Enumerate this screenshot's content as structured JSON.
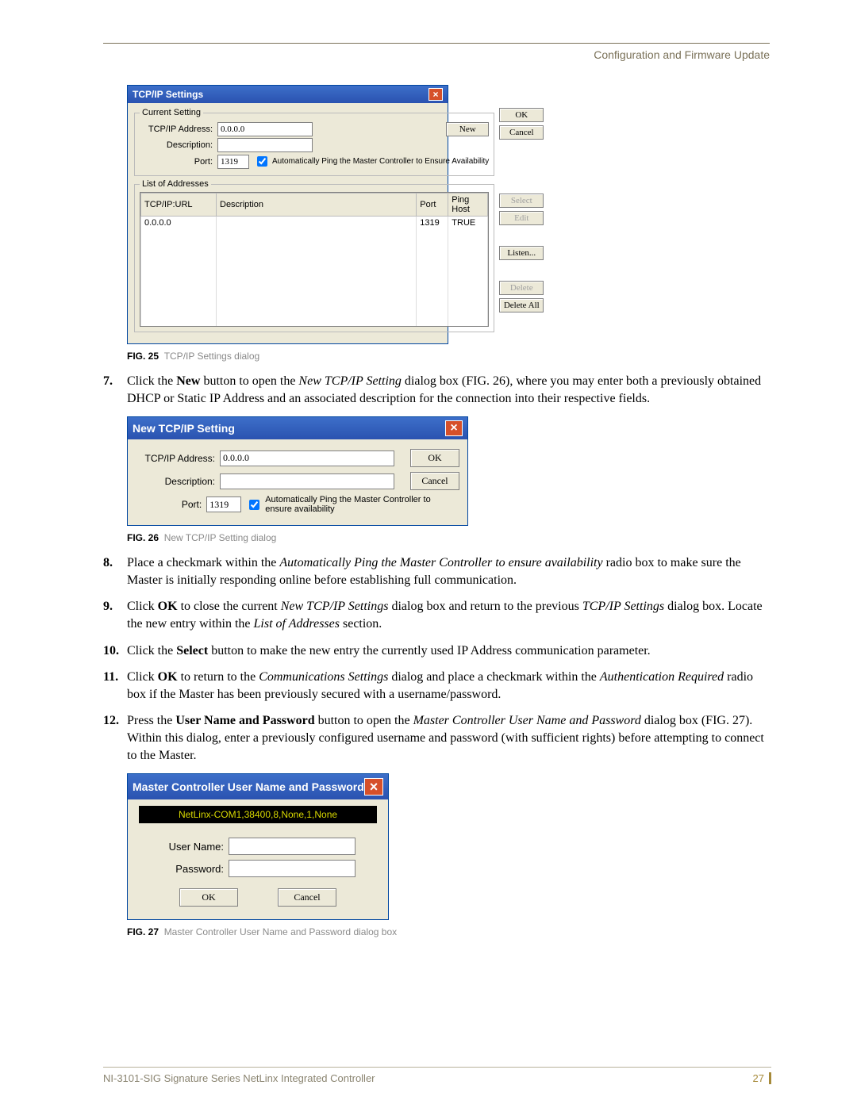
{
  "header": {
    "title": "Configuration and Firmware Update"
  },
  "fig25": {
    "caption_prefix": "FIG. 25",
    "caption": "TCP/IP Settings dialog",
    "title": "TCP/IP Settings",
    "grp_current": "Current Setting",
    "lbl_addr": "TCP/IP Address:",
    "val_addr": "0.0.0.0",
    "lbl_desc": "Description:",
    "lbl_port": "Port:",
    "val_port": "1319",
    "chk_ping": "Automatically Ping the Master Controller to Ensure Availability",
    "btn_new": "New",
    "btn_ok": "OK",
    "btn_cancel": "Cancel",
    "grp_list": "List of Addresses",
    "cols": {
      "c1": "TCP/IP:URL",
      "c2": "Description",
      "c3": "Port",
      "c4": "Ping Host"
    },
    "row1": {
      "c1": "0.0.0.0",
      "c2": "",
      "c3": "1319",
      "c4": "TRUE"
    },
    "btn_select": "Select",
    "btn_edit": "Edit",
    "btn_listen": "Listen...",
    "btn_delete": "Delete",
    "btn_delete_all": "Delete All"
  },
  "steps": {
    "s7": {
      "num": "7.",
      "pre": "Click the ",
      "b1": "New",
      "mid1": " button to open the ",
      "i1": "New TCP/IP Setting",
      "mid2": " dialog box (FIG. 26), where you may enter both a previously obtained DHCP or Static IP Address and an associated description for the connection into their respective fields."
    },
    "s8": {
      "num": "8.",
      "pre": "Place a checkmark within the ",
      "i1": "Automatically Ping the Master Controller to ensure availability",
      "post": " radio box to make sure the Master is initially responding online before establishing full communication."
    },
    "s9": {
      "num": "9.",
      "pre": "Click ",
      "b1": "OK",
      "mid1": " to close the current ",
      "i1": "New TCP/IP Settings",
      "mid2": " dialog box and return to the previous ",
      "i2": "TCP/IP Settings",
      "mid3": " dialog box. Locate the new entry within the ",
      "i3": "List of Addresses",
      "post": " section."
    },
    "s10": {
      "num": "10.",
      "pre": "Click the ",
      "b1": "Select",
      "post": " button to make the new entry the currently used IP Address communication parameter."
    },
    "s11": {
      "num": "11.",
      "pre": "Click ",
      "b1": "OK",
      "mid1": " to return to the ",
      "i1": "Communications Settings",
      "mid2": " dialog and place a checkmark within the ",
      "i2": "Authentication Required",
      "post": " radio box if the Master has been previously secured with a username/password."
    },
    "s12": {
      "num": "12.",
      "pre": "Press the ",
      "b1": "User Name and Password",
      "mid1": " button to open the ",
      "i1": "Master Controller User Name and Password",
      "post": " dialog box (FIG. 27). Within this dialog, enter a previously configured username and password (with sufficient rights) before attempting to connect to the Master."
    }
  },
  "fig26": {
    "caption_prefix": "FIG. 26",
    "caption": "New TCP/IP Setting dialog",
    "title": "New TCP/IP Setting",
    "lbl_addr": "TCP/IP Address:",
    "val_addr": "0.0.0.0",
    "lbl_desc": "Description:",
    "lbl_port": "Port:",
    "val_port": "1319",
    "chk_ping": "Automatically Ping the Master Controller to ensure availability",
    "btn_ok": "OK",
    "btn_cancel": "Cancel"
  },
  "fig27": {
    "caption_prefix": "FIG. 27",
    "caption": "Master Controller User Name and Password dialog box",
    "title": "Master Controller User Name and Password",
    "conn": "NetLinx-COM1,38400,8,None,1,None",
    "lbl_user": "User Name:",
    "lbl_pass": "Password:",
    "btn_ok": "OK",
    "btn_cancel": "Cancel"
  },
  "footer": {
    "doc": "NI-3101-SIG Signature Series NetLinx Integrated Controller",
    "page": "27"
  }
}
